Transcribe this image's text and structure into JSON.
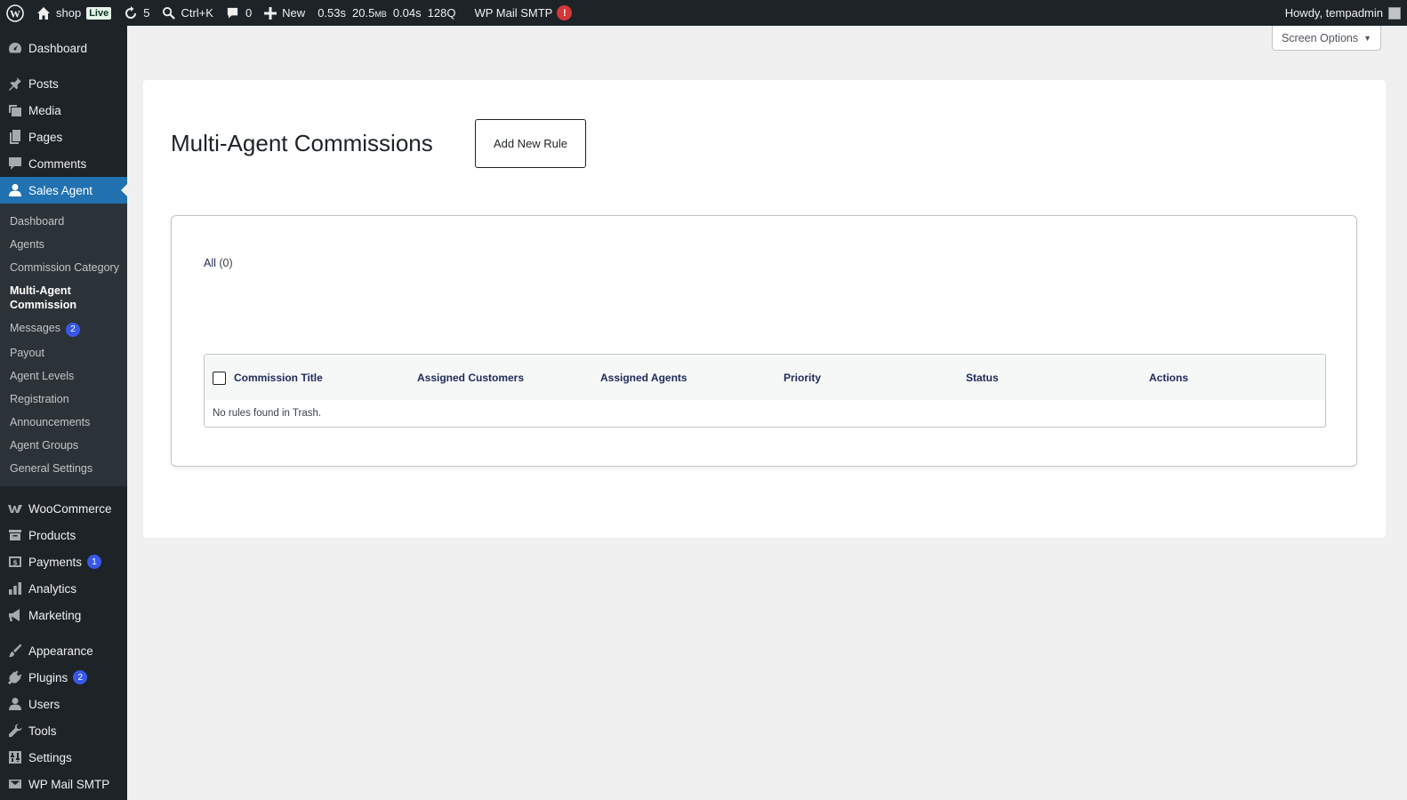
{
  "adminbar": {
    "site_name": "shop",
    "live_label": "Live",
    "updates_count": "5",
    "search_shortcut": "Ctrl+K",
    "comments_count": "0",
    "new_label": "New",
    "metric_time": "0.53s",
    "metric_memory": "20.5",
    "metric_memory_unit": "MB",
    "metric_query_time": "0.04s",
    "metric_queries": "128Q",
    "smtp_label": "WP Mail SMTP",
    "smtp_alert": "!",
    "howdy": "Howdy, tempadmin"
  },
  "sidebar": {
    "top_items": [
      {
        "label": "Dashboard",
        "icon": "dashboard-icon"
      },
      {
        "label": "Posts",
        "icon": "pin-icon"
      },
      {
        "label": "Media",
        "icon": "media-icon"
      },
      {
        "label": "Pages",
        "icon": "pages-icon"
      },
      {
        "label": "Comments",
        "icon": "comment-icon"
      },
      {
        "label": "Sales Agent",
        "icon": "user-icon"
      }
    ],
    "submenu": [
      {
        "label": "Dashboard"
      },
      {
        "label": "Agents"
      },
      {
        "label": "Commission Category"
      },
      {
        "label": "Multi-Agent Commission"
      },
      {
        "label": "Messages",
        "badge": "2"
      },
      {
        "label": "Payout"
      },
      {
        "label": "Agent Levels"
      },
      {
        "label": "Registration"
      },
      {
        "label": "Announcements"
      },
      {
        "label": "Agent Groups"
      },
      {
        "label": "General Settings"
      }
    ],
    "bottom_items": [
      {
        "label": "WooCommerce",
        "icon": "woocommerce-icon"
      },
      {
        "label": "Products",
        "icon": "archive-icon"
      },
      {
        "label": "Payments",
        "icon": "payments-icon",
        "badge": "1"
      },
      {
        "label": "Analytics",
        "icon": "chart-bar-icon"
      },
      {
        "label": "Marketing",
        "icon": "megaphone-icon"
      },
      {
        "label": "Appearance",
        "icon": "brush-icon"
      },
      {
        "label": "Plugins",
        "icon": "plugin-icon",
        "badge": "2"
      },
      {
        "label": "Users",
        "icon": "users-icon"
      },
      {
        "label": "Tools",
        "icon": "wrench-icon"
      },
      {
        "label": "Settings",
        "icon": "settings-icon"
      },
      {
        "label": "WP Mail SMTP",
        "icon": "mail-icon"
      }
    ]
  },
  "screen_options": {
    "label": "Screen Options"
  },
  "page": {
    "title": "Multi-Agent Commissions",
    "add_button": "Add New Rule",
    "filter_all_label": "All",
    "filter_all_count": "(0)",
    "table": {
      "columns": [
        "Commission Title",
        "Assigned Customers",
        "Assigned Agents",
        "Priority",
        "Status",
        "Actions"
      ],
      "empty_message": "No rules found in Trash."
    }
  },
  "colors": {
    "adminbar_bg": "#1d2327",
    "menu_current": "#2271b1",
    "link_navy": "#1e2a5a"
  }
}
